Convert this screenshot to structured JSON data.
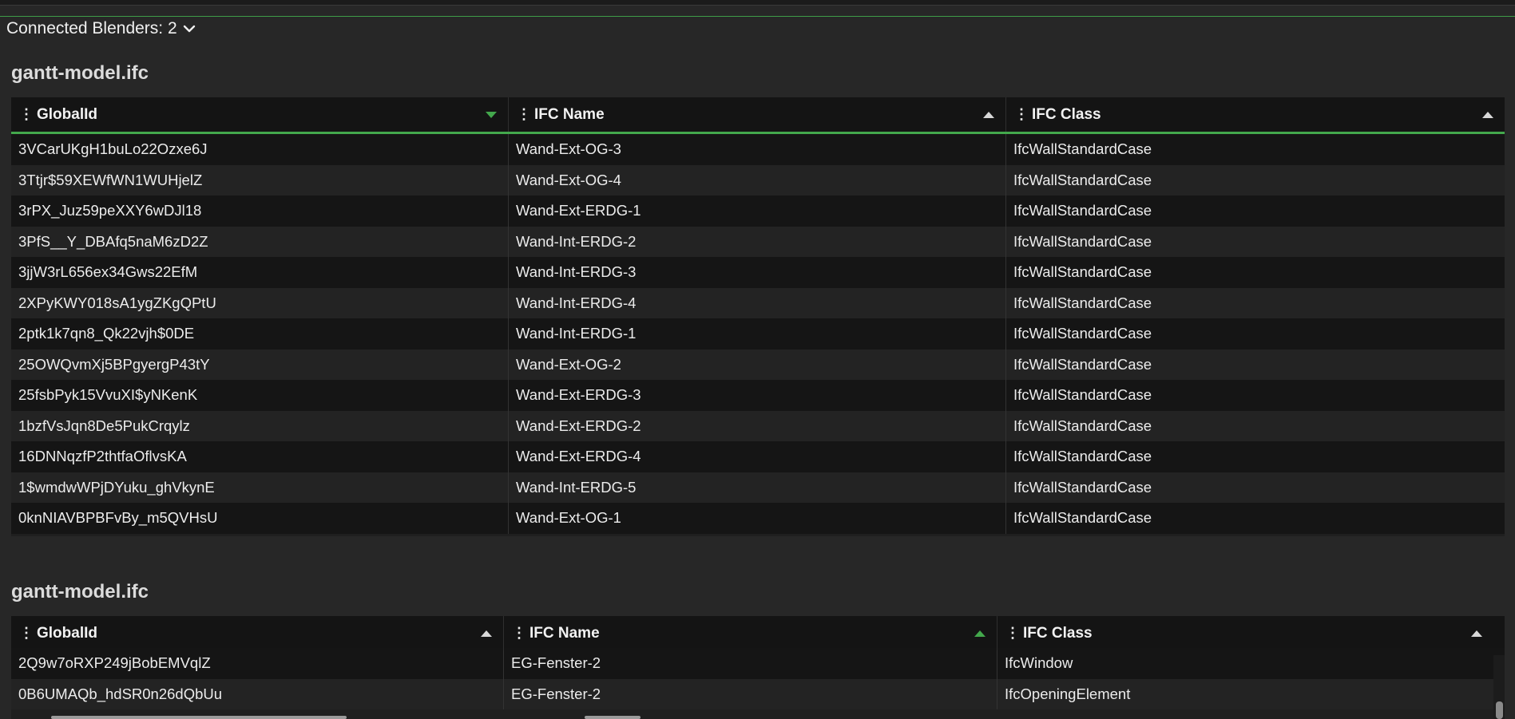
{
  "connected": {
    "label": "Connected Blenders: 2"
  },
  "colors": {
    "accent": "#43a84c",
    "background": "#272727",
    "header": "#141414"
  },
  "sections": [
    {
      "title": "gantt-model.ifc",
      "columns": [
        {
          "label": "GlobalId",
          "sort": "desc",
          "sort_active": true
        },
        {
          "label": "IFC Name",
          "sort": "asc",
          "sort_active": false
        },
        {
          "label": "IFC Class",
          "sort": "asc",
          "sort_active": false
        }
      ],
      "rows": [
        [
          "3VCarUKgH1buLo22Ozxe6J",
          "Wand-Ext-OG-3",
          "IfcWallStandardCase"
        ],
        [
          "3Ttjr$59XEWfWN1WUHjelZ",
          "Wand-Ext-OG-4",
          "IfcWallStandardCase"
        ],
        [
          "3rPX_Juz59peXXY6wDJl18",
          "Wand-Ext-ERDG-1",
          "IfcWallStandardCase"
        ],
        [
          "3PfS__Y_DBAfq5naM6zD2Z",
          "Wand-Int-ERDG-2",
          "IfcWallStandardCase"
        ],
        [
          "3jjW3rL656ex34Gws22EfM",
          "Wand-Int-ERDG-3",
          "IfcWallStandardCase"
        ],
        [
          "2XPyKWY018sA1ygZKgQPtU",
          "Wand-Int-ERDG-4",
          "IfcWallStandardCase"
        ],
        [
          "2ptk1k7qn8_Qk22vjh$0DE",
          "Wand-Int-ERDG-1",
          "IfcWallStandardCase"
        ],
        [
          "25OWQvmXj5BPgyergP43tY",
          "Wand-Ext-OG-2",
          "IfcWallStandardCase"
        ],
        [
          "25fsbPyk15VvuXI$yNKenK",
          "Wand-Ext-ERDG-3",
          "IfcWallStandardCase"
        ],
        [
          "1bzfVsJqn8De5PukCrqylz",
          "Wand-Ext-ERDG-2",
          "IfcWallStandardCase"
        ],
        [
          "16DNNqzfP2thtfaOflvsKA",
          "Wand-Ext-ERDG-4",
          "IfcWallStandardCase"
        ],
        [
          "1$wmdwWPjDYuku_ghVkynE",
          "Wand-Int-ERDG-5",
          "IfcWallStandardCase"
        ],
        [
          "0knNIAVBPBFvBy_m5QVHsU",
          "Wand-Ext-OG-1",
          "IfcWallStandardCase"
        ]
      ]
    },
    {
      "title": "gantt-model.ifc",
      "columns": [
        {
          "label": "GlobalId",
          "sort": "asc",
          "sort_active": false
        },
        {
          "label": "IFC Name",
          "sort": "asc",
          "sort_active": true
        },
        {
          "label": "IFC Class",
          "sort": "asc",
          "sort_active": false
        }
      ],
      "rows": [
        [
          "2Q9w7oRXP249jBobEMVqlZ",
          "EG-Fenster-2",
          "IfcWindow"
        ],
        [
          "0B6UMAQb_hdSR0n26dQbUu",
          "EG-Fenster-2",
          "IfcOpeningElement"
        ]
      ]
    }
  ]
}
